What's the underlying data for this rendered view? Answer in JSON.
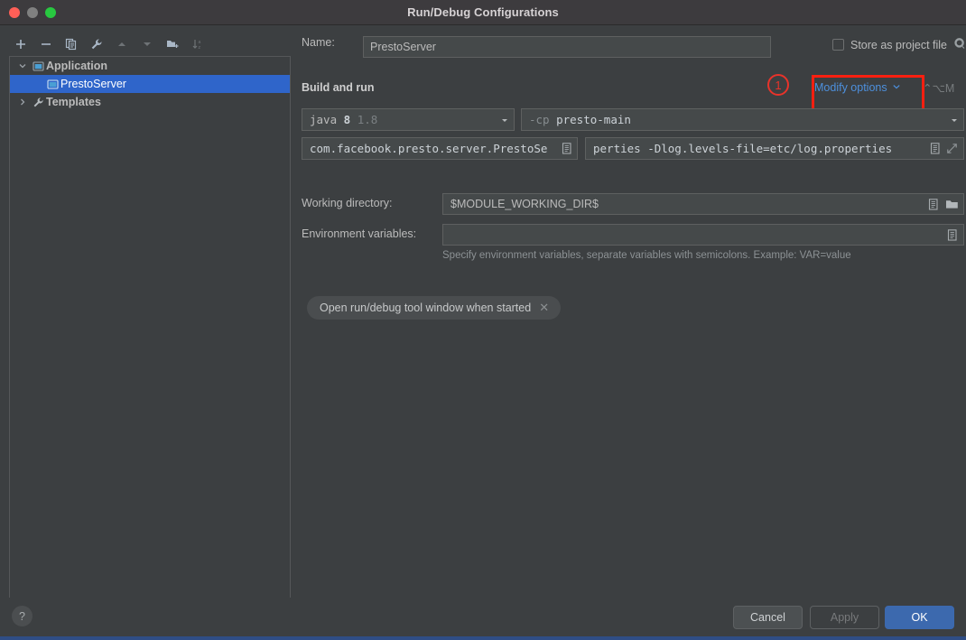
{
  "window": {
    "title": "Run/Debug Configurations",
    "traffic_lights": [
      "close",
      "minimize",
      "maximize"
    ]
  },
  "toolbar": {
    "buttons": [
      {
        "name": "add-configuration",
        "icon": "plus-icon"
      },
      {
        "name": "remove-configuration",
        "icon": "minus-icon"
      },
      {
        "name": "copy-configuration",
        "icon": "copy-icon"
      },
      {
        "name": "edit-templates",
        "icon": "wrench-icon"
      },
      {
        "name": "move-up",
        "icon": "arrow-up-icon"
      },
      {
        "name": "move-down",
        "icon": "arrow-down-icon"
      },
      {
        "name": "move-into-folder",
        "icon": "folder-add-icon"
      },
      {
        "name": "sort-configurations",
        "icon": "sort-az-icon"
      }
    ]
  },
  "tree": {
    "items": [
      {
        "label": "Application",
        "level": 0,
        "expanded": true,
        "icon": "application-icon",
        "selected": false
      },
      {
        "label": "PrestoServer",
        "level": 1,
        "expanded": null,
        "icon": "application-icon",
        "selected": true
      },
      {
        "label": "Templates",
        "level": 0,
        "expanded": false,
        "icon": "wrench-icon",
        "selected": false
      }
    ]
  },
  "form": {
    "name_label": "Name:",
    "name_value": "PrestoServer",
    "store_as_project_file_label": "Store as project file",
    "store_as_project_file_checked": false,
    "section_title": "Build and run",
    "modify_options_label": "Modify options",
    "modify_options_shortcut": "⌃⌥M",
    "jdk_value_prefix": "java",
    "jdk_value_version": "8",
    "jdk_value_dim": "1.8",
    "classpath_flag": "-cp",
    "classpath_module": "presto-main",
    "main_class_value": "com.facebook.presto.server.PrestoSe",
    "vm_options_value": "perties -Dlog.levels-file=etc/log.properties",
    "working_directory_label": "Working directory:",
    "working_directory_value": "$MODULE_WORKING_DIR$",
    "environment_variables_label": "Environment variables:",
    "environment_variables_value": "",
    "environment_hint": "Specify environment variables, separate variables with semicolons. Example: VAR=value",
    "chip_label": "Open run/debug tool window when started"
  },
  "annotation": {
    "marker_number": "1",
    "marker_color": "#e8332a",
    "highlight_color": "#fb1f10"
  },
  "footer": {
    "help_label": "?",
    "cancel_label": "Cancel",
    "apply_label": "Apply",
    "apply_enabled": false,
    "ok_label": "OK"
  },
  "colors": {
    "background": "#3c3f41",
    "selection_blue": "#2f65ca",
    "link_blue": "#4d90dd",
    "ok_button": "#3c69ae"
  }
}
